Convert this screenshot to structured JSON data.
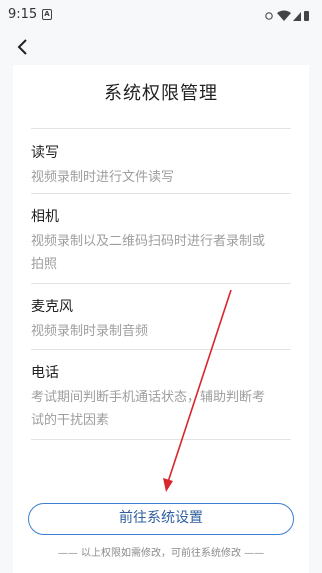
{
  "status_bar": {
    "time": "9:15",
    "notification_icon": "A"
  },
  "header": {
    "back_icon": "chevron-left-icon"
  },
  "page": {
    "title": "系统权限管理"
  },
  "permissions": [
    {
      "title": "读写",
      "desc_lines": [
        "视频录制时进行文件读写"
      ]
    },
    {
      "title": "相机",
      "desc_lines": [
        "视频录制以及二维码扫码时进行者录制或",
        "拍照"
      ]
    },
    {
      "title": "麦克风",
      "desc_lines": [
        "视频录制时录制音频"
      ]
    },
    {
      "title": "电话",
      "desc_lines": [
        "考试期间判断手机通话状态，辅助判断考",
        "试的干扰因素"
      ]
    }
  ],
  "actions": {
    "settings_button": "前往系统设置",
    "footer_note": "—— 以上权限如需修改，可前往系统修改 ——"
  },
  "colors": {
    "accent": "#3b7fd0",
    "annotation_arrow": "#d9262c"
  }
}
